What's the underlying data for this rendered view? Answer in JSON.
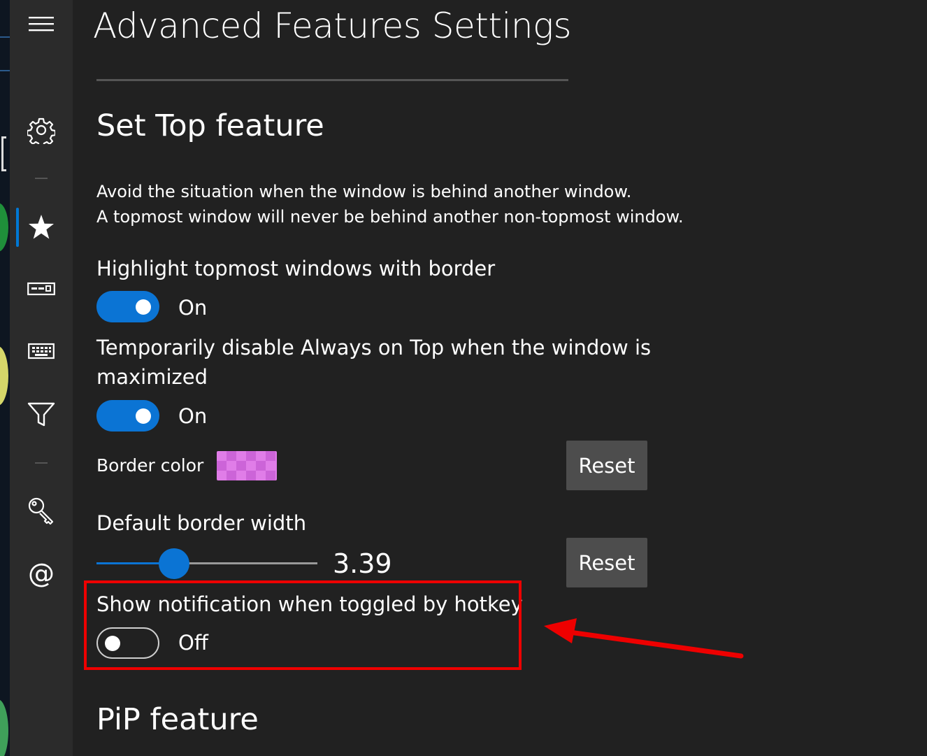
{
  "nav": {
    "items": [
      {
        "name": "menu-icon",
        "glyph": "hamburger"
      },
      {
        "name": "settings-gear-icon",
        "glyph": "gear"
      },
      {
        "name": "star-icon",
        "glyph": "star",
        "selected": true
      },
      {
        "name": "window-layout-icon",
        "glyph": "window"
      },
      {
        "name": "keyboard-icon",
        "glyph": "keyboard"
      },
      {
        "name": "filter-icon",
        "glyph": "funnel"
      },
      {
        "name": "key-icon",
        "glyph": "key"
      },
      {
        "name": "at-sign-icon",
        "glyph": "at"
      }
    ],
    "at_glyph": "@"
  },
  "page": {
    "title": "Advanced Features Settings"
  },
  "set_top": {
    "heading": "Set Top feature",
    "description_line1": "Avoid the situation when the window is behind another window.",
    "description_line2": "A topmost window will never be behind another non-topmost window.",
    "highlight": {
      "label": "Highlight topmost windows with border",
      "state": "On",
      "enabled": true
    },
    "disable_maximized": {
      "label": "Temporarily disable Always on Top when the window is maximized",
      "state": "On",
      "enabled": true
    },
    "border_color": {
      "label": "Border color",
      "color": "#e07de8",
      "reset_label": "Reset"
    },
    "border_width": {
      "label": "Default border width",
      "value": "3.39",
      "slider_fraction": 0.35,
      "reset_label": "Reset"
    },
    "notification": {
      "label": "Show notification when toggled by hotkey",
      "state": "Off",
      "enabled": false
    }
  },
  "pip": {
    "heading": "PiP feature"
  },
  "colors": {
    "accent": "#0b74d4",
    "background": "#212121",
    "nav_background": "#2b2b2b",
    "annotation_red": "#ee0000",
    "button": "#4d4d4d"
  }
}
